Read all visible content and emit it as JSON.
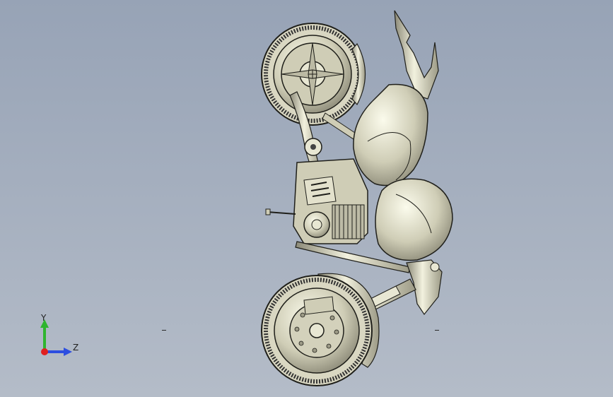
{
  "viewport": {
    "background_top": "#97a3b6",
    "background_bottom": "#b4bcc8",
    "model_name": "motorcycle-assembly",
    "view_orientation": "side"
  },
  "triad": {
    "y_label": "Y",
    "z_label": "Z",
    "y_color": "#2fb52f",
    "z_color": "#2c4ee0",
    "x_color": "#e02020"
  },
  "colors": {
    "metal_light": "#eeeeda",
    "metal_mid": "#b9b7a0",
    "metal_dark": "#6e6c5e",
    "outline": "#1f1f1a"
  }
}
